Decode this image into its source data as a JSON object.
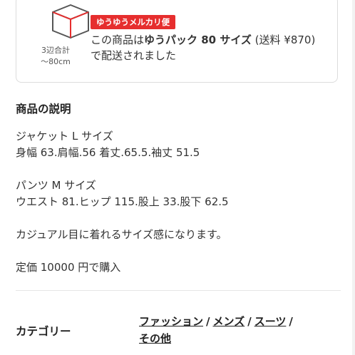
{
  "shipping": {
    "badge": "ゆうゆうメルカリ便",
    "size_limit_line1": "3辺合計",
    "size_limit_line2": "～80cm",
    "text_prefix": "この商品は",
    "text_bold": "ゆうパック 80 サイズ",
    "text_suffix": " (送料 ¥870) で配送されました",
    "accent_color": "#e62e2e"
  },
  "description": {
    "title": "商品の説明",
    "lines": [
      "ジャケット L サイズ",
      "身幅 63.肩幅.56 着丈.65.5.袖丈 51.5",
      "",
      "パンツ M サイズ",
      "ウエスト 81.ヒップ 115.股上 33.股下 62.5",
      "",
      "カジュアル目に着れるサイズ感になります。",
      "",
      "定価 10000 円で購入"
    ]
  },
  "category": {
    "label": "カテゴリー",
    "links": [
      "ファッション",
      "メンズ",
      "スーツ",
      "その他"
    ],
    "separator": "/"
  },
  "icons": {
    "box": "package-box-icon"
  }
}
